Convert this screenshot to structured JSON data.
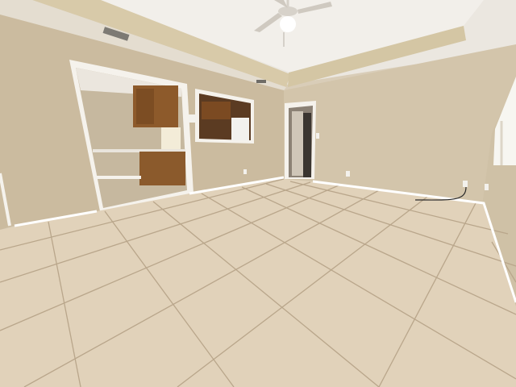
{
  "scene": {
    "description_hidden": "",
    "colors": {
      "wall": "#cfc0a5",
      "wall_shadow": "#bfae92",
      "wall_right": "#d6c9b0",
      "ceiling": "#ebe7e0",
      "ceiling_tray": "#f1eee9",
      "soffit": "#d8caa9",
      "floor": "#e3d3bb",
      "floor_near": "#d9c7ab",
      "grout": "#b9a68b",
      "baseboard": "#ffffff",
      "cabinet": "#8d5a2b",
      "cabinet_dark": "#6a3f1c",
      "kitchen_wall": "#c8bba3",
      "trim": "#f5f2ec",
      "doorway_dark": "#3a3530"
    },
    "icons": [
      "ceiling-fan-icon",
      "ceiling-light-icon",
      "air-vent-icon",
      "outlet-icon",
      "thermostat-icon"
    ]
  }
}
